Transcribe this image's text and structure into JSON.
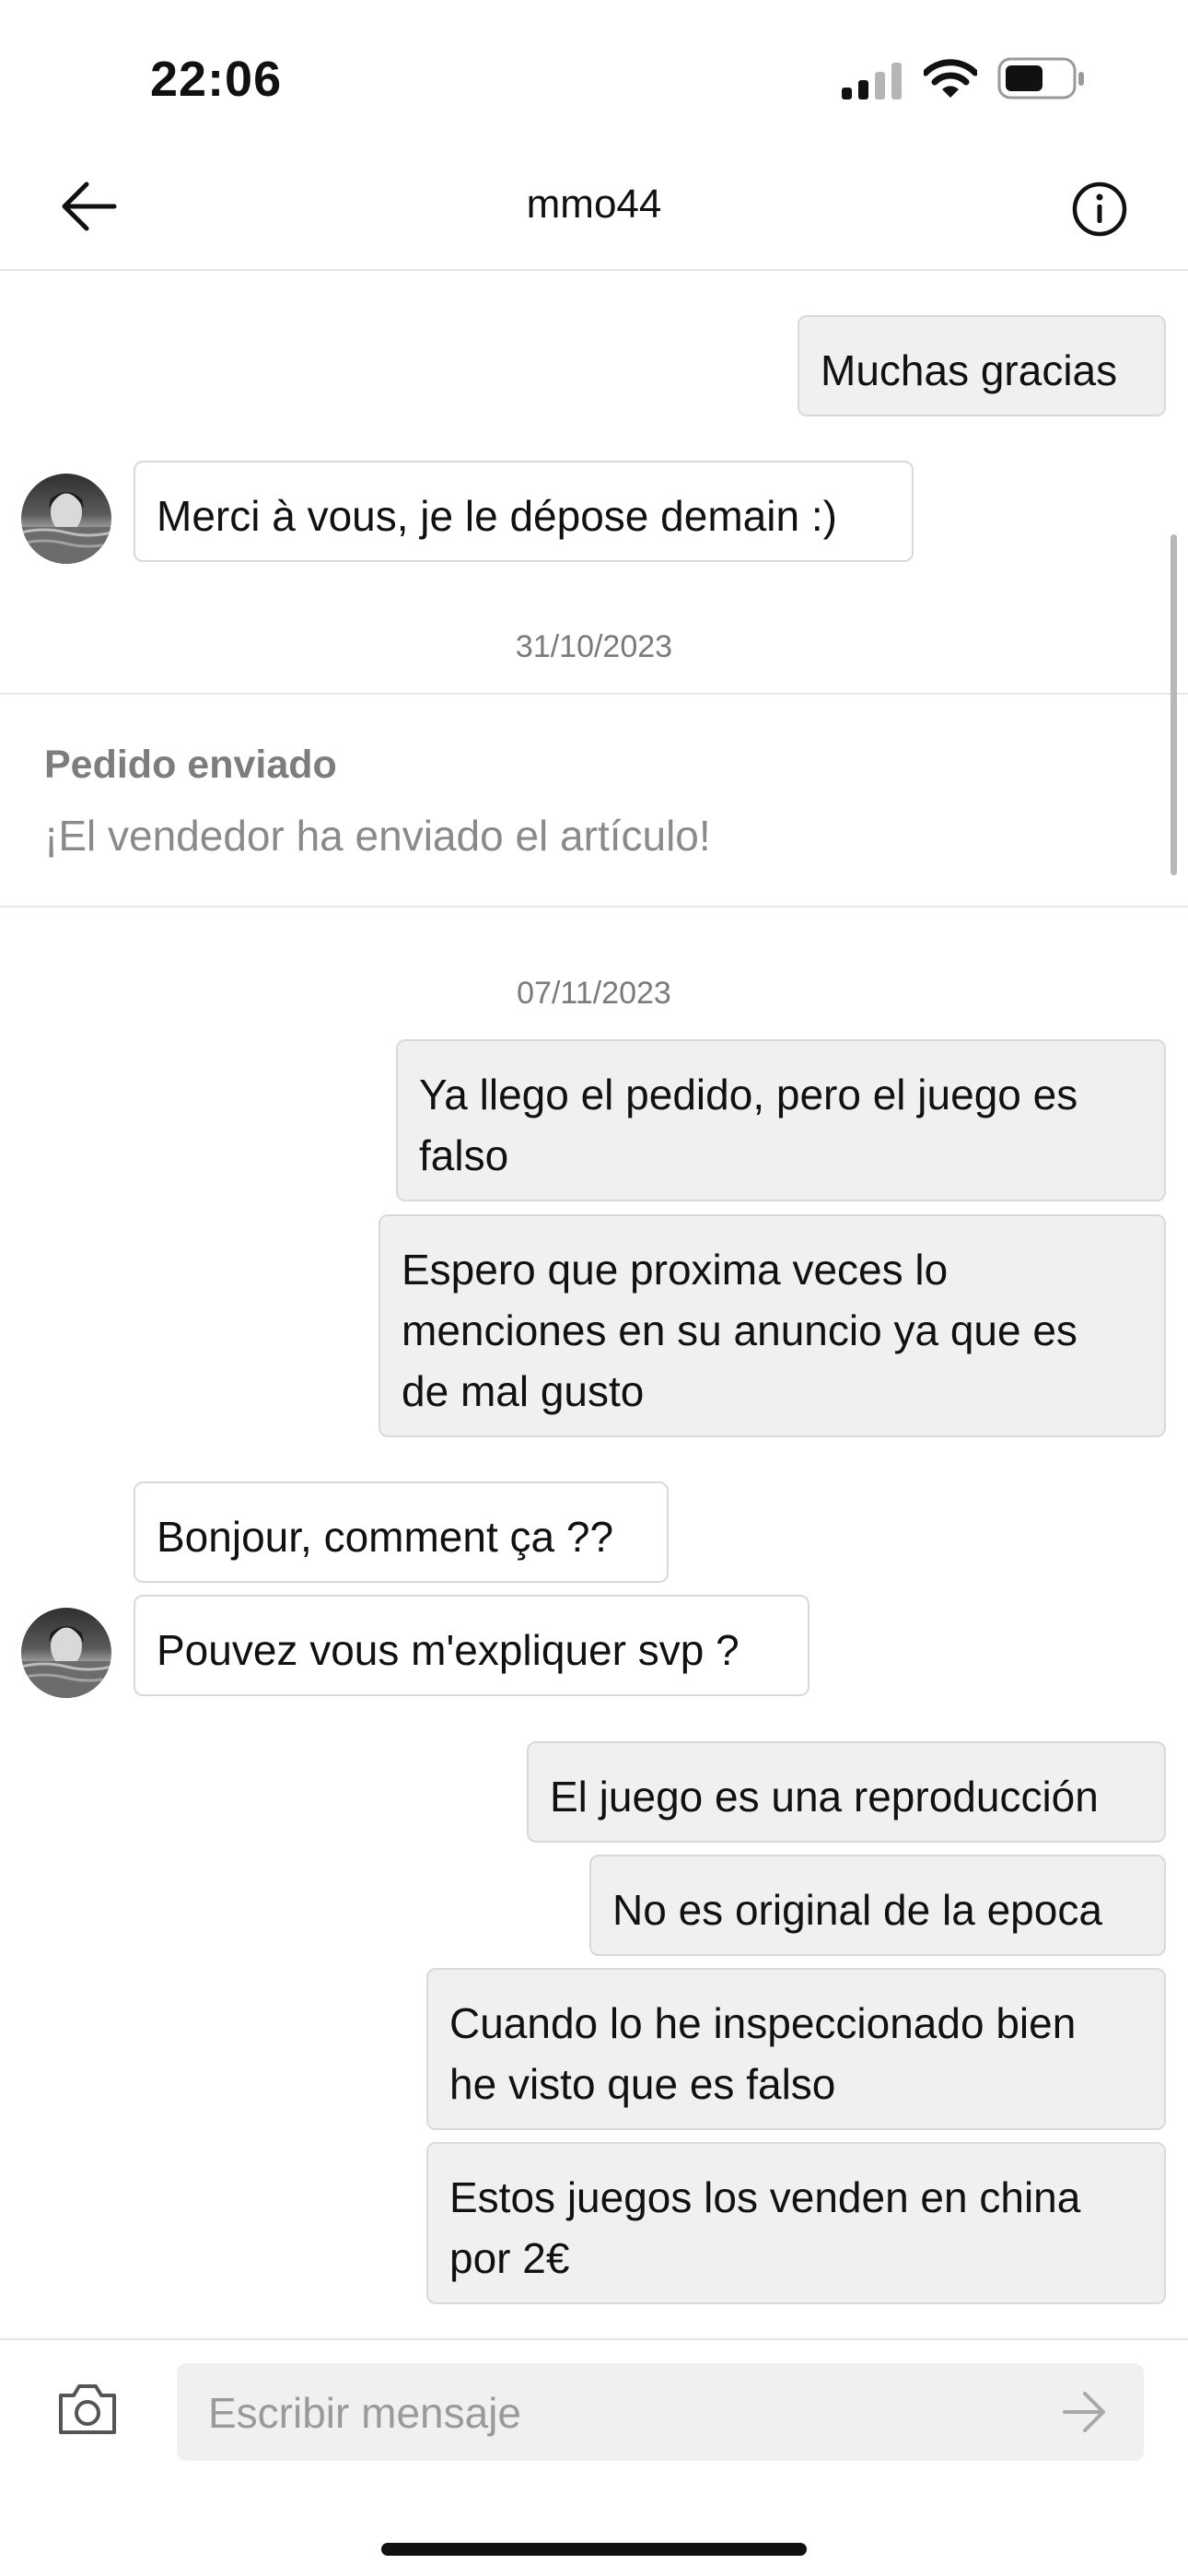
{
  "status_bar": {
    "time": "22:06",
    "signal_icon": "cellular-signal-icon",
    "wifi_icon": "wifi-icon",
    "battery_icon": "battery-icon"
  },
  "header": {
    "title": "mmo44",
    "back_icon": "arrow-left-icon",
    "info_icon": "info-icon"
  },
  "messages_top": {
    "msg1": "Muchas gracias",
    "msg2": "Merci à vous, je le dépose demain :)"
  },
  "date1": "31/10/2023",
  "system_notice": {
    "title": "Pedido enviado",
    "body": "¡El vendedor ha enviado el artículo!"
  },
  "date2": "07/11/2023",
  "messages": {
    "m3": "Ya llego el pedido, pero el juego es\nfalso",
    "m4": "Espero que proxima veces lo\nmenciones en su anuncio ya que es\nde mal gusto",
    "m5": "Bonjour, comment ça ??",
    "m6": "Pouvez vous m'expliquer svp ?",
    "m7": "El juego es una reproducción",
    "m8": "No es original de la epoca",
    "m9": "Cuando lo he inspeccionado bien\nhe visto que es falso",
    "m10": "Estos juegos los venden en china\npor 2€"
  },
  "composer": {
    "placeholder": "Escribir mensaje",
    "camera_icon": "camera-icon",
    "send_icon": "send-arrow-icon"
  },
  "colors": {
    "outgoing_bubble": "#f0f0f0",
    "incoming_bubble": "#ffffff",
    "bubble_border": "#d9d9d9",
    "muted_text": "#7a7a7a"
  }
}
